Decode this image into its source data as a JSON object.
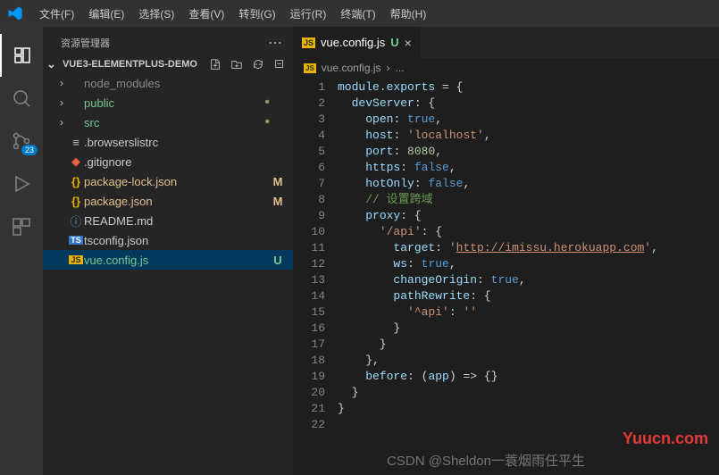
{
  "menu": {
    "items": [
      "文件(F)",
      "编辑(E)",
      "选择(S)",
      "查看(V)",
      "转到(G)",
      "运行(R)",
      "终端(T)",
      "帮助(H)"
    ]
  },
  "activitybar": {
    "badge": "23"
  },
  "sidebar": {
    "title": "资源管理器",
    "project": "VUE3-ELEMENTPLUS-DEMO",
    "items": [
      {
        "label": "node_modules",
        "kind": "folder",
        "dim": true
      },
      {
        "label": "public",
        "kind": "folder",
        "status": "",
        "dot": true,
        "git": "untrk"
      },
      {
        "label": "src",
        "kind": "folder",
        "status": "",
        "dot": true,
        "git": "untrk"
      },
      {
        "label": ".browserslistrc",
        "kind": "file",
        "icon": "lines"
      },
      {
        "label": ".gitignore",
        "kind": "file",
        "icon": "git"
      },
      {
        "label": "package-lock.json",
        "kind": "file",
        "icon": "braces",
        "status": "M",
        "git": "modified"
      },
      {
        "label": "package.json",
        "kind": "file",
        "icon": "braces",
        "status": "M",
        "git": "modified"
      },
      {
        "label": "README.md",
        "kind": "file",
        "icon": "info"
      },
      {
        "label": "tsconfig.json",
        "kind": "file",
        "icon": "ts"
      },
      {
        "label": "vue.config.js",
        "kind": "file",
        "icon": "js",
        "status": "U",
        "git": "untrk",
        "selected": true
      }
    ]
  },
  "tab": {
    "name": "vue.config.js",
    "status": "U"
  },
  "breadcrumb": {
    "file": "vue.config.js",
    "sep": "›",
    "more": "..."
  },
  "code": {
    "lines": [
      [
        [
          "module",
          "tok-key"
        ],
        [
          ".",
          "tok-punc"
        ],
        [
          "exports",
          "tok-key"
        ],
        [
          " = {",
          "tok-punc"
        ]
      ],
      [
        [
          "  ",
          ""
        ],
        [
          "devServer",
          "tok-prop"
        ],
        [
          ": {",
          "tok-punc"
        ]
      ],
      [
        [
          "    ",
          ""
        ],
        [
          "open",
          "tok-prop"
        ],
        [
          ": ",
          "tok-punc"
        ],
        [
          "true",
          "tok-bool"
        ],
        [
          ",",
          "tok-punc"
        ]
      ],
      [
        [
          "    ",
          ""
        ],
        [
          "host",
          "tok-prop"
        ],
        [
          ": ",
          "tok-punc"
        ],
        [
          "'localhost'",
          "tok-str"
        ],
        [
          ",",
          "tok-punc"
        ]
      ],
      [
        [
          "    ",
          ""
        ],
        [
          "port",
          "tok-prop"
        ],
        [
          ": ",
          "tok-punc"
        ],
        [
          "8080",
          "tok-num"
        ],
        [
          ",",
          "tok-punc"
        ]
      ],
      [
        [
          "    ",
          ""
        ],
        [
          "https",
          "tok-prop"
        ],
        [
          ": ",
          "tok-punc"
        ],
        [
          "false",
          "tok-bool"
        ],
        [
          ",",
          "tok-punc"
        ]
      ],
      [
        [
          "    ",
          ""
        ],
        [
          "hotOnly",
          "tok-prop"
        ],
        [
          ": ",
          "tok-punc"
        ],
        [
          "false",
          "tok-bool"
        ],
        [
          ",",
          "tok-punc"
        ]
      ],
      [
        [
          "    ",
          ""
        ],
        [
          "// 设置跨域",
          "tok-com"
        ]
      ],
      [
        [
          "    ",
          ""
        ],
        [
          "proxy",
          "tok-prop"
        ],
        [
          ": {",
          "tok-punc"
        ]
      ],
      [
        [
          "      ",
          ""
        ],
        [
          "'/api'",
          "tok-str"
        ],
        [
          ": {",
          "tok-punc"
        ]
      ],
      [
        [
          "        ",
          ""
        ],
        [
          "target",
          "tok-prop"
        ],
        [
          ": ",
          "tok-punc"
        ],
        [
          "'",
          "tok-str"
        ],
        [
          "http://imissu.herokuapp.com",
          "tok-link"
        ],
        [
          "'",
          "tok-str"
        ],
        [
          ",",
          "tok-punc"
        ]
      ],
      [
        [
          "        ",
          ""
        ],
        [
          "ws",
          "tok-prop"
        ],
        [
          ": ",
          "tok-punc"
        ],
        [
          "true",
          "tok-bool"
        ],
        [
          ",",
          "tok-punc"
        ]
      ],
      [
        [
          "        ",
          ""
        ],
        [
          "changeOrigin",
          "tok-prop"
        ],
        [
          ": ",
          "tok-punc"
        ],
        [
          "true",
          "tok-bool"
        ],
        [
          ",",
          "tok-punc"
        ]
      ],
      [
        [
          "        ",
          ""
        ],
        [
          "pathRewrite",
          "tok-prop"
        ],
        [
          ": {",
          "tok-punc"
        ]
      ],
      [
        [
          "          ",
          ""
        ],
        [
          "'^api'",
          "tok-str"
        ],
        [
          ": ",
          "tok-punc"
        ],
        [
          "''",
          "tok-str"
        ]
      ],
      [
        [
          "        }",
          "tok-punc"
        ]
      ],
      [
        [
          "      }",
          "tok-punc"
        ]
      ],
      [
        [
          "    },",
          "tok-punc"
        ]
      ],
      [
        [
          "    ",
          ""
        ],
        [
          "before",
          "tok-prop"
        ],
        [
          ": (",
          "tok-punc"
        ],
        [
          "app",
          "tok-param"
        ],
        [
          ") => {}",
          "tok-punc"
        ]
      ],
      [
        [
          "  }",
          "tok-punc"
        ]
      ],
      [
        [
          "}",
          "tok-punc"
        ]
      ],
      [
        [
          "",
          ""
        ]
      ]
    ]
  },
  "watermark": {
    "site": "Yuucn.com",
    "author": "CSDN @Sheldon一蓑烟雨任平生"
  }
}
